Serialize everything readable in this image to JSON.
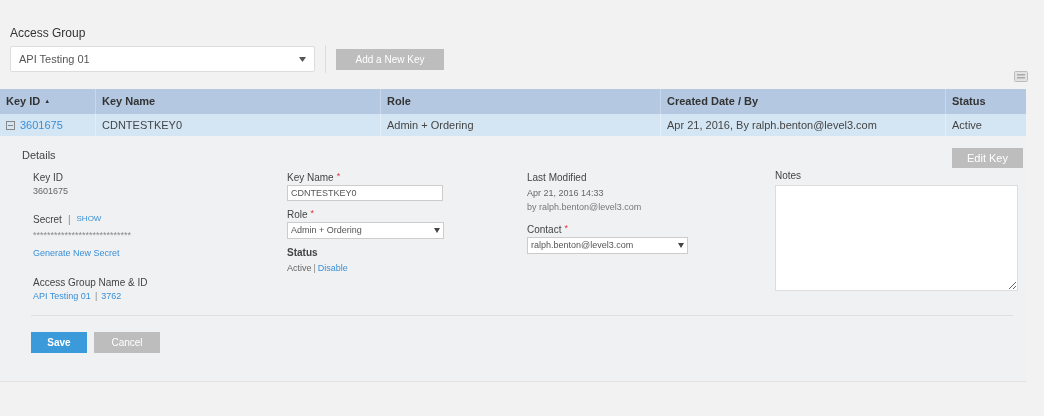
{
  "access_group": {
    "label": "Access Group",
    "value": "API Testing 01",
    "add_button": "Add a New Key"
  },
  "table": {
    "columns": [
      {
        "label": "Key ID",
        "sort_icon": "▲"
      },
      {
        "label": "Key Name"
      },
      {
        "label": "Role"
      },
      {
        "label": "Created Date / By"
      },
      {
        "label": "Status"
      }
    ],
    "rows": [
      {
        "expanded": true,
        "selected": true,
        "cells": [
          "3601675",
          "CDNTESTKEY0",
          "Admin + Ordering",
          "Apr 21, 2016, By ralph.benton@level3.com",
          "Active"
        ]
      }
    ]
  },
  "details": {
    "title": "Details",
    "edit_button": "Edit Key",
    "key_id": {
      "label": "Key ID",
      "value": "3601675"
    },
    "secret": {
      "label": "Secret",
      "separator": "|",
      "show_link": "SHOW",
      "value": "****************************",
      "generate_link": "Generate New Secret"
    },
    "access_group": {
      "label": "Access Group Name & ID",
      "name": "API Testing 01",
      "separator": "|",
      "id": "3762"
    },
    "key_name": {
      "label": "Key Name",
      "required_mark": "*",
      "value": "CDNTESTKEY0"
    },
    "role": {
      "label": "Role",
      "required_mark": "*",
      "value": "Admin + Ordering"
    },
    "status": {
      "label": "Status",
      "value": "Active",
      "separator": "|",
      "action": "Disable"
    },
    "last_modified": {
      "label": "Last Modified",
      "date": "Apr 21, 2016 14:33",
      "by": "by ralph.benton@level3.com"
    },
    "contact": {
      "label": "Contact",
      "required_mark": "*",
      "value": "ralph.benton@level3.com"
    },
    "notes": {
      "label": "Notes"
    },
    "buttons": [
      {
        "label": "Save",
        "kind": "primary"
      },
      {
        "label": "Cancel",
        "kind": "secondary"
      }
    ]
  }
}
